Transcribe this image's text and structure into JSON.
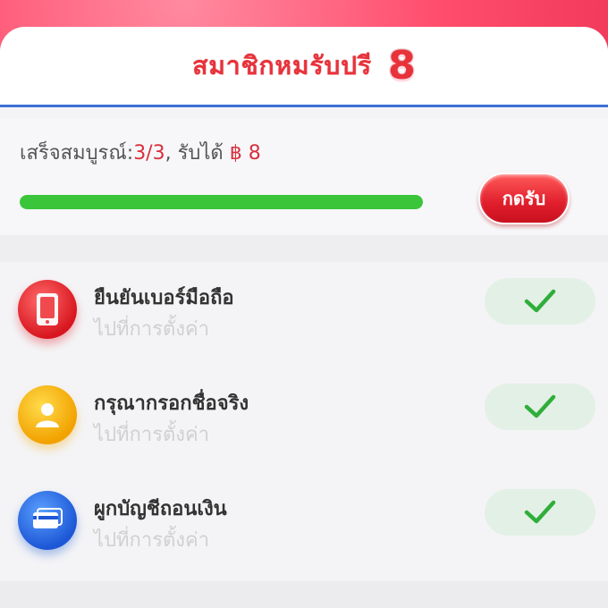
{
  "header": {
    "title": "สมาชิกหมรับปรี",
    "title_number": "8"
  },
  "progress": {
    "label_prefix": "เสร็จสมบูรณ์:",
    "completed_text": "3/3",
    "reward_prefix": ", รับได้ ",
    "reward_amount": "฿ 8",
    "fraction": 1.0
  },
  "claim_button": {
    "label": "กดรับ"
  },
  "tasks": [
    {
      "title": "ยืนยันเบอร์มือถือ",
      "subtitle": "ไปที่การตั้งค่า",
      "icon": "phone-icon",
      "status": "completed"
    },
    {
      "title": "กรุณากรอกชื่อจริง",
      "subtitle": "ไปที่การตั้งค่า",
      "icon": "user-icon",
      "status": "completed"
    },
    {
      "title": "ผูกบัญชีถอนเงิน",
      "subtitle": "ไปที่การตั้งค่า",
      "icon": "bank-card-icon",
      "status": "completed"
    }
  ],
  "colors": {
    "accent_red": "#e8323a",
    "progress_green": "#3ac53a",
    "check_green": "#2fae3a",
    "header_line_blue": "#3e6fd6"
  }
}
